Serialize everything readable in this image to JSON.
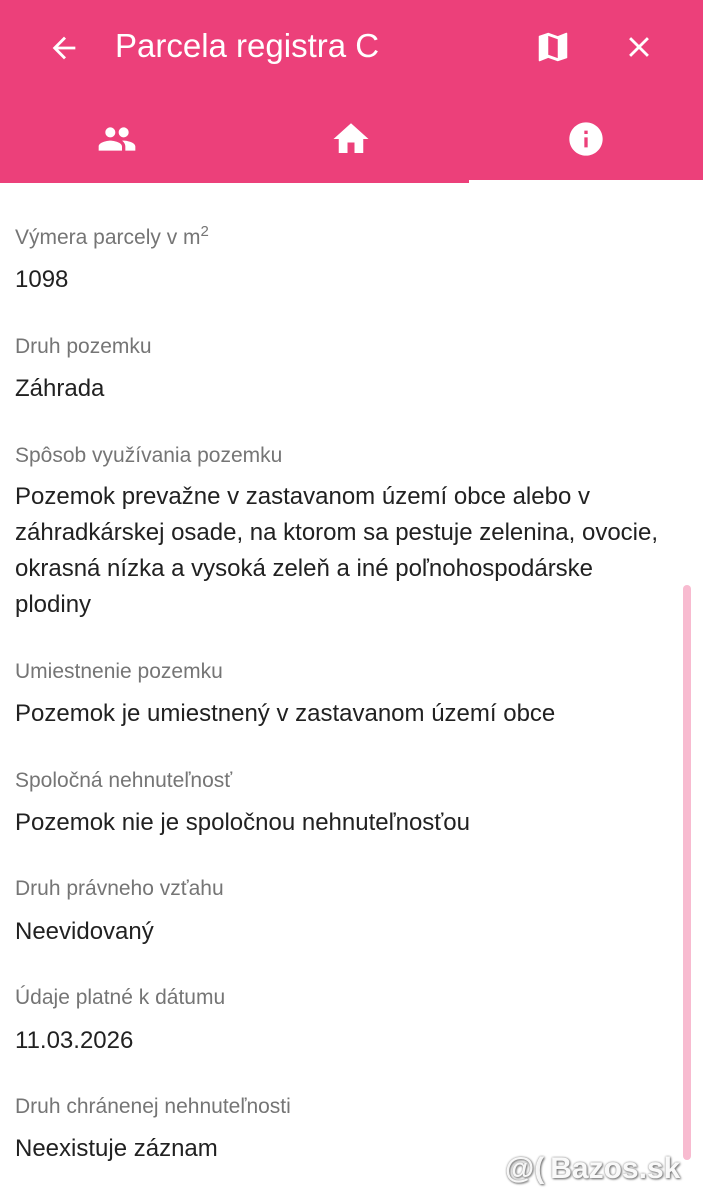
{
  "header": {
    "title": "Parcela registra C",
    "icons": {
      "back": "arrow-back-icon",
      "map": "map-icon",
      "close": "close-icon"
    }
  },
  "tabs": [
    {
      "icon": "people-icon",
      "active": false
    },
    {
      "icon": "home-icon",
      "active": false
    },
    {
      "icon": "info-icon",
      "active": true
    }
  ],
  "fields": [
    {
      "label": "Výmera parcely v m",
      "label_sup": "2",
      "value": "1098"
    },
    {
      "label": "Druh pozemku",
      "value": "Záhrada"
    },
    {
      "label": "Spôsob využívania pozemku",
      "value": "Pozemok prevažne v zastavanom území obce alebo v záhradkárskej osade, na ktorom sa pestuje zelenina, ovocie, okrasná nízka a vysoká zeleň a iné poľnohospodárske plodiny"
    },
    {
      "label": "Umiestnenie pozemku",
      "value": "Pozemok je umiestnený v zastavanom území obce"
    },
    {
      "label": "Spoločná nehnuteľnosť",
      "value": "Pozemok nie je spoločnou nehnuteľnosťou"
    },
    {
      "label": "Druh právneho vzťahu",
      "value": "Neevidovaný"
    },
    {
      "label": "Údaje platné k dátumu",
      "value": "11.03.2026"
    },
    {
      "label": "Druh chránenej nehnuteľnosti",
      "value": "Neexistuje záznam"
    }
  ],
  "watermark": {
    "symbol": "@(",
    "text": "Bazos.sk"
  },
  "colors": {
    "accent": "#ec407a",
    "label": "#757575",
    "value": "#212121",
    "scrollbar": "#f8bbd0"
  }
}
